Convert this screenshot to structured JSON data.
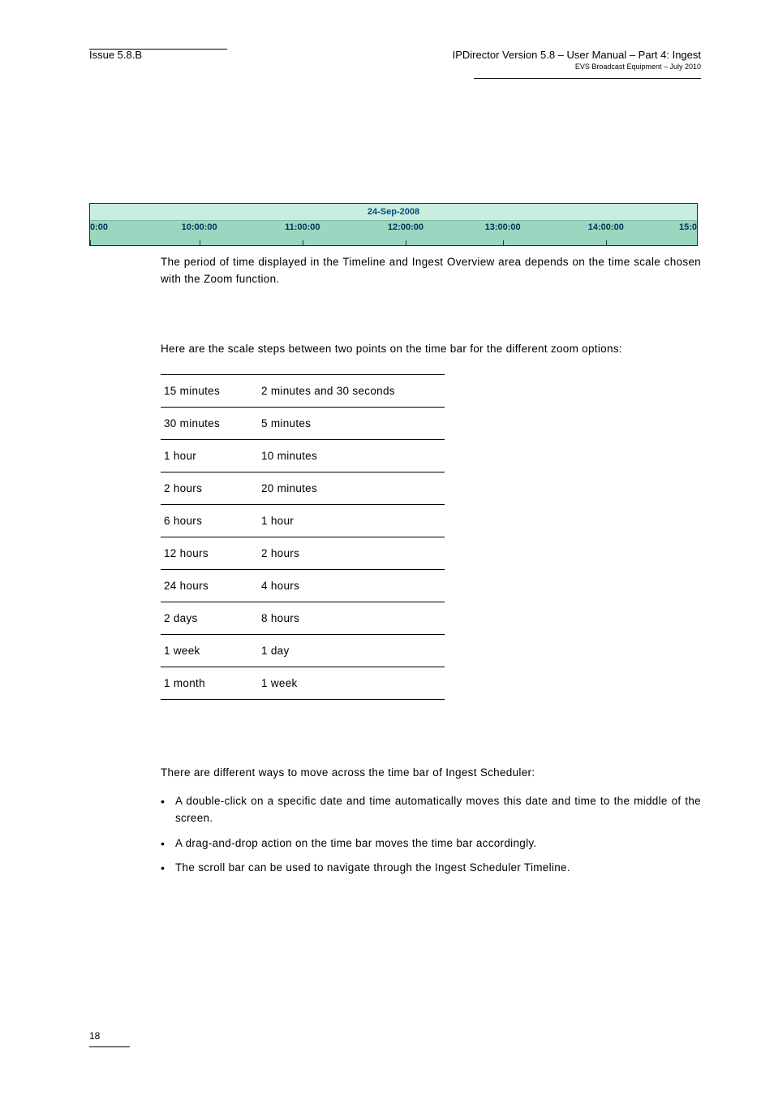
{
  "header": {
    "issue": "Issue 5.8.B",
    "title": "IPDirector Version 5.8 – User Manual – Part 4: Ingest",
    "subtitle": "EVS Broadcast Equipment – July 2010"
  },
  "timebar": {
    "date": "24-Sep-2008",
    "ticks": [
      {
        "label": "0:00",
        "pos": 0
      },
      {
        "label": "10:00:00",
        "pos": 18
      },
      {
        "label": "11:00:00",
        "pos": 35
      },
      {
        "label": "12:00:00",
        "pos": 52
      },
      {
        "label": "13:00:00",
        "pos": 68
      },
      {
        "label": "14:00:00",
        "pos": 85
      },
      {
        "label": "15:0",
        "pos": 100
      }
    ]
  },
  "para1": "The period of time displayed in the Timeline and Ingest Overview area depends on the time scale chosen with the Zoom function.",
  "para2": "Here are the scale steps between two points on the time bar for the different zoom options:",
  "zoom_table": [
    {
      "zoom": "15 minutes",
      "step": "2 minutes and 30 seconds"
    },
    {
      "zoom": "30 minutes",
      "step": "5 minutes"
    },
    {
      "zoom": "1 hour",
      "step": "10 minutes"
    },
    {
      "zoom": "2 hours",
      "step": "20 minutes"
    },
    {
      "zoom": "6 hours",
      "step": "1 hour"
    },
    {
      "zoom": "12 hours",
      "step": "2 hours"
    },
    {
      "zoom": "24 hours",
      "step": "4 hours"
    },
    {
      "zoom": "2 days",
      "step": "8 hours"
    },
    {
      "zoom": "1 week",
      "step": "1 day"
    },
    {
      "zoom": "1 month",
      "step": "1 week"
    }
  ],
  "para3": "There are different ways to move across the time bar of Ingest Scheduler:",
  "bullets": [
    "A double-click on a specific date and time automatically moves this date and time to the middle of the screen.",
    "A drag-and-drop action on the time bar moves the time bar accordingly.",
    "The scroll bar can be used to navigate through the Ingest Scheduler Timeline."
  ],
  "footer": {
    "page": "18"
  }
}
